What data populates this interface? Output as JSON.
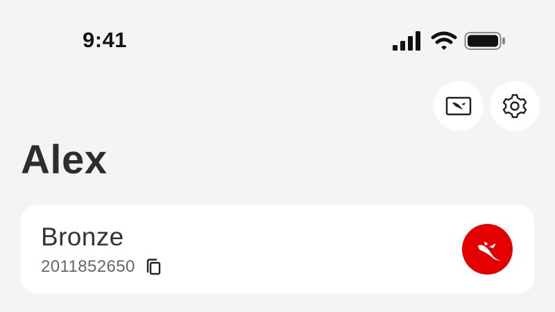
{
  "status_bar": {
    "time": "9:41",
    "signal_icon": "cellular-signal-icon",
    "wifi_icon": "wifi-icon",
    "battery_icon": "battery-icon"
  },
  "header": {
    "card_mode_icon": "card-kangaroo-icon",
    "settings_icon": "gear-icon"
  },
  "profile": {
    "name": "Alex"
  },
  "membership": {
    "tier": "Bronze",
    "member_number": "2011852650",
    "copy_icon": "copy-icon",
    "logo_icon": "kangaroo-logo-icon",
    "logo_color": "#e40000"
  },
  "colors": {
    "background": "#f4f4f4",
    "card": "#ffffff",
    "accent": "#e40000",
    "text_primary": "#2f2f2f",
    "text_secondary": "#666666"
  }
}
